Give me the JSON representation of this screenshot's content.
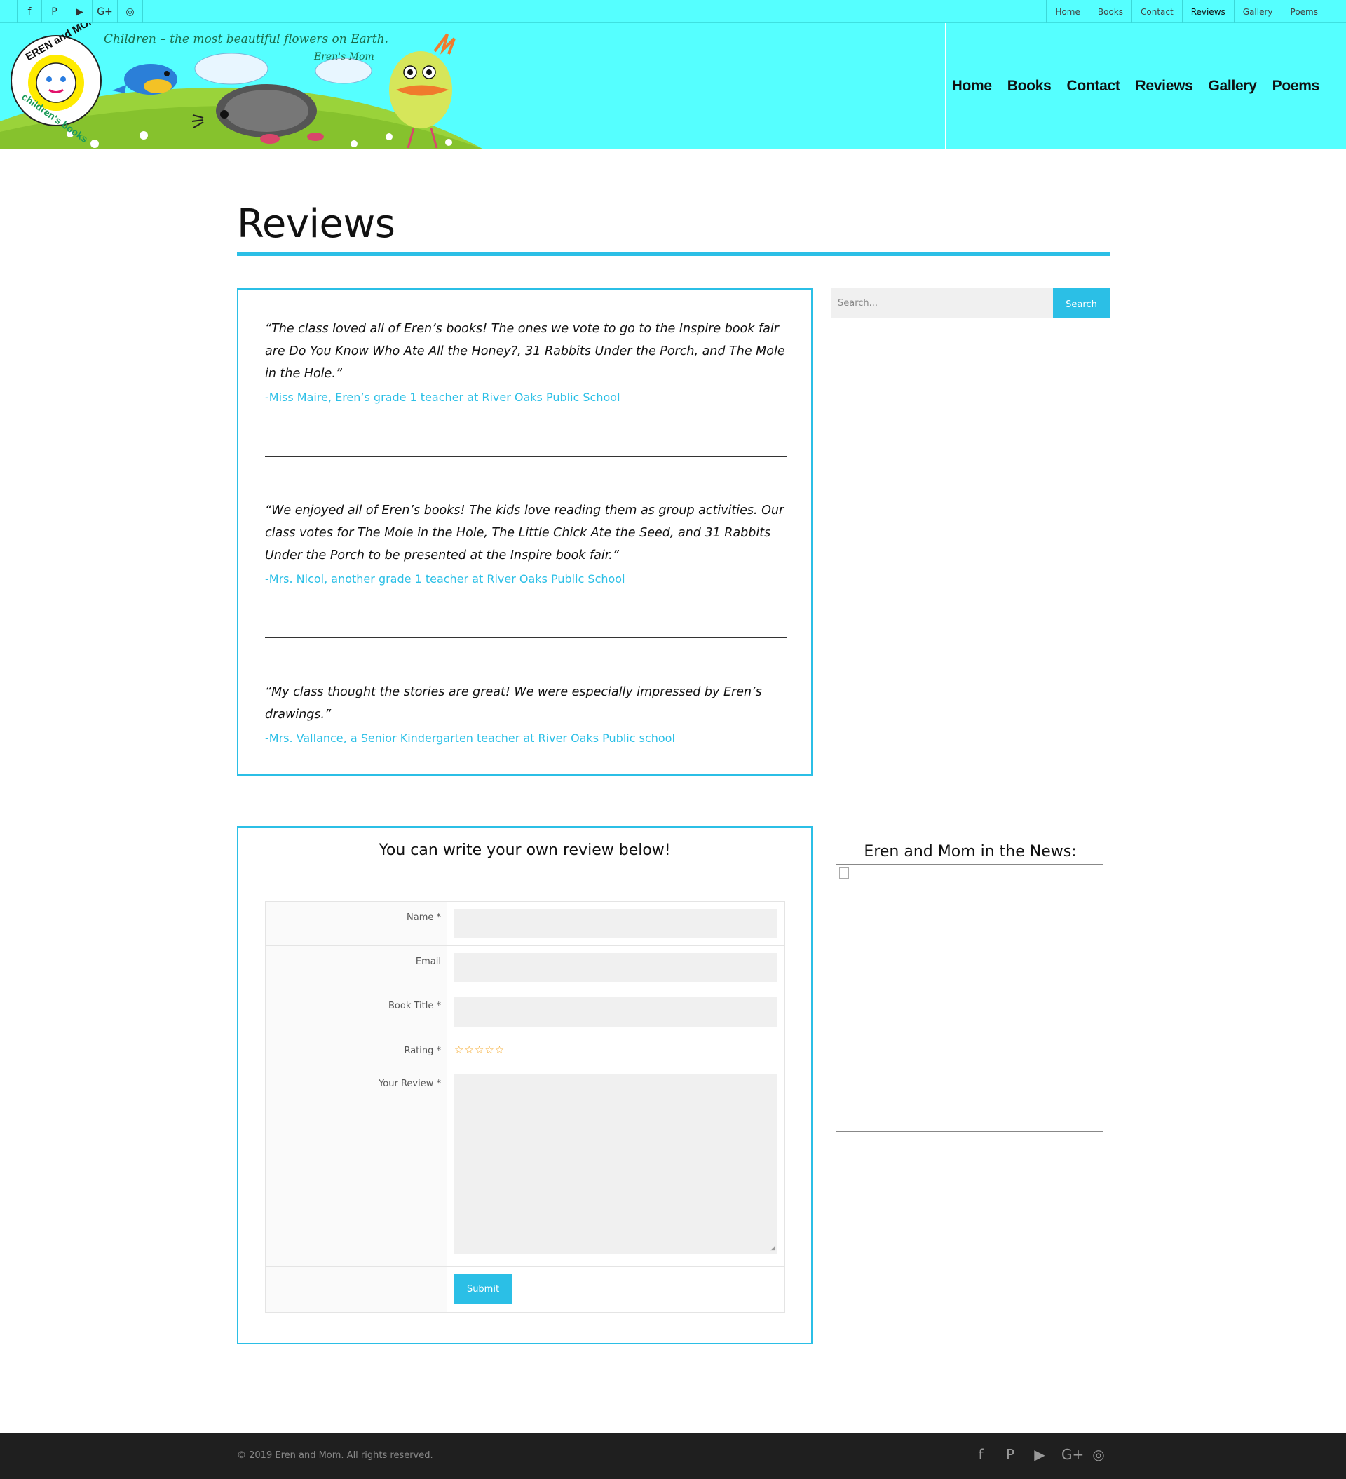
{
  "topbar": {
    "social_icons": [
      "facebook-icon",
      "pinterest-icon",
      "youtube-icon",
      "google-plus-icon",
      "instagram-icon"
    ],
    "social_glyphs": [
      "f",
      "P",
      "▶",
      "G+",
      "◎"
    ],
    "links": [
      "Home",
      "Books",
      "Contact",
      "Reviews",
      "Gallery",
      "Poems"
    ],
    "active_link": "Reviews"
  },
  "header": {
    "logo_text": "EREN and MOM",
    "logo_subtext": "children's books",
    "tagline": "Children – the most beautiful flowers on Earth.",
    "tagline_attribution": "Eren's Mom",
    "nav": [
      "Home",
      "Books",
      "Contact",
      "Reviews",
      "Gallery",
      "Poems"
    ]
  },
  "page": {
    "title": "Reviews"
  },
  "reviews": [
    {
      "quote": "“The class loved all of Eren’s books! The ones we vote to go to the Inspire book fair are Do You Know Who Ate All the Honey?, 31 Rabbits Under the Porch, and The Mole in the Hole.”",
      "author": "-Miss Maire, Eren’s grade 1 teacher at River Oaks Public School"
    },
    {
      "quote": "“We enjoyed all of Eren’s books! The kids love reading them as group activities. Our class votes for The Mole in the Hole, The Little Chick Ate the Seed, and 31 Rabbits Under the Porch to be presented at the Inspire book fair.”",
      "author": "-Mrs. Nicol, another grade 1 teacher at River Oaks Public School"
    },
    {
      "quote": "“My class thought the stories are great! We were especially impressed by Eren’s drawings.”",
      "author": "-Mrs. Vallance, a Senior Kindergarten teacher at River Oaks Public school"
    }
  ],
  "search": {
    "placeholder": "Search...",
    "button_label": "Search"
  },
  "form": {
    "heading": "You can write your own review below!",
    "name_label": "Name *",
    "email_label": "Email",
    "book_title_label": "Book Title *",
    "rating_label": "Rating *",
    "rating_stars": "☆☆☆☆☆",
    "review_label": "Your Review *",
    "submit_label": "Submit"
  },
  "news": {
    "title": "Eren and Mom in the News:"
  },
  "footer": {
    "copyright": "© 2019 Eren and Mom. All rights reserved.",
    "social_icons": [
      "facebook-icon",
      "pinterest-icon",
      "youtube-icon",
      "google-plus-icon",
      "instagram-icon"
    ],
    "social_glyphs": [
      "f",
      "P",
      "▶",
      "G+",
      "◎"
    ]
  },
  "colors": {
    "header_bg": "#55ffff",
    "accent": "#2bbfe6",
    "footer_bg": "#1f1f1f"
  }
}
